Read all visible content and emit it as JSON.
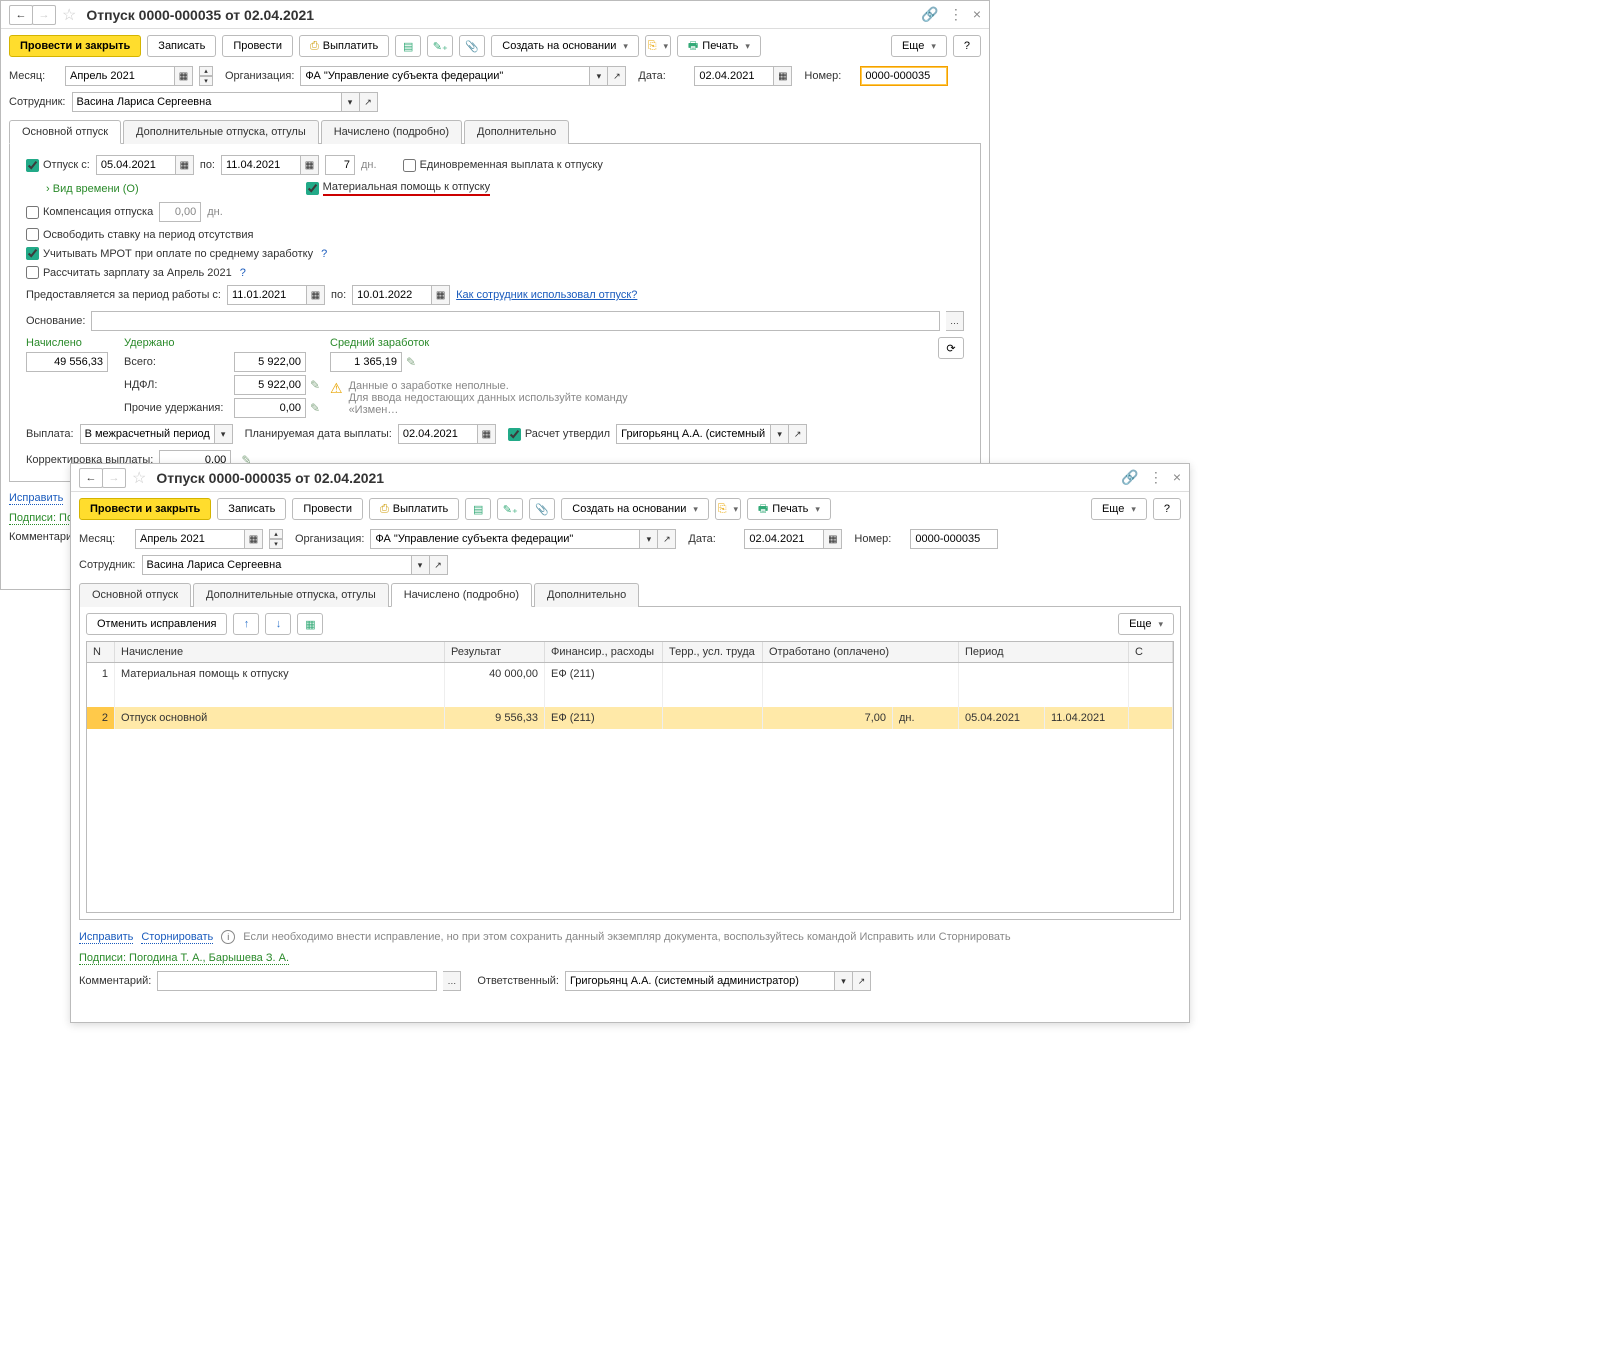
{
  "w1": {
    "title": "Отпуск 0000-000035 от 02.04.2021",
    "toolbar": {
      "post_close": "Провести и закрыть",
      "save": "Записать",
      "post": "Провести",
      "pay": "Выплатить",
      "create_based": "Создать на основании",
      "print": "Печать",
      "more": "Еще",
      "help": "?"
    },
    "header": {
      "month_lbl": "Месяц:",
      "month": "Апрель 2021",
      "org_lbl": "Организация:",
      "org": "ФА \"Управление субъекта федерации\"",
      "date_lbl": "Дата:",
      "date": "02.04.2021",
      "number_lbl": "Номер:",
      "number": "0000-000035",
      "emp_lbl": "Сотрудник:",
      "emp": "Васина Лариса Сергеевна"
    },
    "tabs": [
      "Основной отпуск",
      "Дополнительные отпуска, отгулы",
      "Начислено (подробно)",
      "Дополнительно"
    ],
    "main": {
      "vacation_lbl": "Отпуск  с:",
      "from": "05.04.2021",
      "to_lbl": "по:",
      "to": "11.04.2021",
      "days": "7",
      "days_lbl": "дн.",
      "onepay": "Единовременная выплата к отпуску",
      "mathelp": "Материальная помощь к отпуску",
      "time_type": "Вид времени (О)",
      "comp_lbl": "Компенсация отпуска",
      "comp_val": "0,00",
      "comp_dn": "дн.",
      "release": "Освободить ставку на период отсутствия",
      "mrot": "Учитывать МРОТ при оплате по среднему заработку",
      "recalc": "Рассчитать зарплату за Апрель 2021",
      "period_lbl": "Предоставляется за период работы с:",
      "period_from": "11.01.2021",
      "period_to_lbl": "по:",
      "period_to": "10.01.2022",
      "how_used": "Как сотрудник использовал отпуск?",
      "basis_lbl": "Основание:",
      "accrued_lbl": "Начислено",
      "accrued": "49 556,33",
      "withheld_lbl": "Удержано",
      "total_lbl": "Всего:",
      "total": "5 922,00",
      "ndfl_lbl": "НДФЛ:",
      "ndfl": "5 922,00",
      "other_lbl": "Прочие удержания:",
      "other": "0,00",
      "avg_lbl": "Средний заработок",
      "avg": "1 365,19",
      "warn1": "Данные о заработке неполные.",
      "warn2": "Для ввода недостающих данных используйте команду «Измен…",
      "pay_lbl": "Выплата:",
      "pay_mode": "В межрасчетный период",
      "plan_date_lbl": "Планируемая дата выплаты:",
      "plan_date": "02.04.2021",
      "approved_lbl": "Расчет утвердил",
      "approved": "Григорьянц А.А. (системный адми",
      "corr_lbl": "Корректировка выплаты:",
      "corr": "0,00"
    },
    "footer": {
      "fix": "Исправить",
      "signs": "Подписи: Пого",
      "comment_lbl": "Комментарий:"
    }
  },
  "w2": {
    "title": "Отпуск 0000-000035 от 02.04.2021",
    "toolbar": {
      "post_close": "Провести и закрыть",
      "save": "Записать",
      "post": "Провести",
      "pay": "Выплатить",
      "create_based": "Создать на основании",
      "print": "Печать",
      "more": "Еще",
      "help": "?"
    },
    "header": {
      "month_lbl": "Месяц:",
      "month": "Апрель 2021",
      "org_lbl": "Организация:",
      "org": "ФА \"Управление субъекта федерации\"",
      "date_lbl": "Дата:",
      "date": "02.04.2021",
      "number_lbl": "Номер:",
      "number": "0000-000035",
      "emp_lbl": "Сотрудник:",
      "emp": "Васина Лариса Сергеевна"
    },
    "tabs": [
      "Основной отпуск",
      "Дополнительные отпуска, отгулы",
      "Начислено (подробно)",
      "Дополнительно"
    ],
    "detail": {
      "cancel": "Отменить исправления",
      "more": "Еще",
      "cols": {
        "n": "N",
        "accrual": "Начисление",
        "result": "Результат",
        "fin": "Финансир., расходы",
        "terr": "Терр., усл. труда",
        "worked": "Отработано (оплачено)",
        "period": "Период",
        "s": "С"
      },
      "rows": [
        {
          "n": "1",
          "accrual": "Материальная помощь к отпуску",
          "result": "40 000,00",
          "fin": "ЕФ  (211)",
          "terr": "",
          "worked": "",
          "wu": "",
          "p1": "",
          "p2": ""
        },
        {
          "n": "2",
          "accrual": "Отпуск основной",
          "result": "9 556,33",
          "fin": "ЕФ  (211)",
          "terr": "",
          "worked": "7,00",
          "wu": "дн.",
          "p1": "05.04.2021",
          "p2": "11.04.2021"
        }
      ]
    },
    "footer": {
      "fix": "Исправить",
      "storno": "Сторнировать",
      "info": "Если необходимо внести исправление, но при этом сохранить данный экземпляр документа, воспользуйтесь командой Исправить или Сторнировать",
      "signs": "Подписи: Погодина Т. А., Барышева З. А.",
      "comment_lbl": "Комментарий:",
      "resp_lbl": "Ответственный:",
      "resp": "Григорьянц А.А. (системный администратор)"
    }
  }
}
